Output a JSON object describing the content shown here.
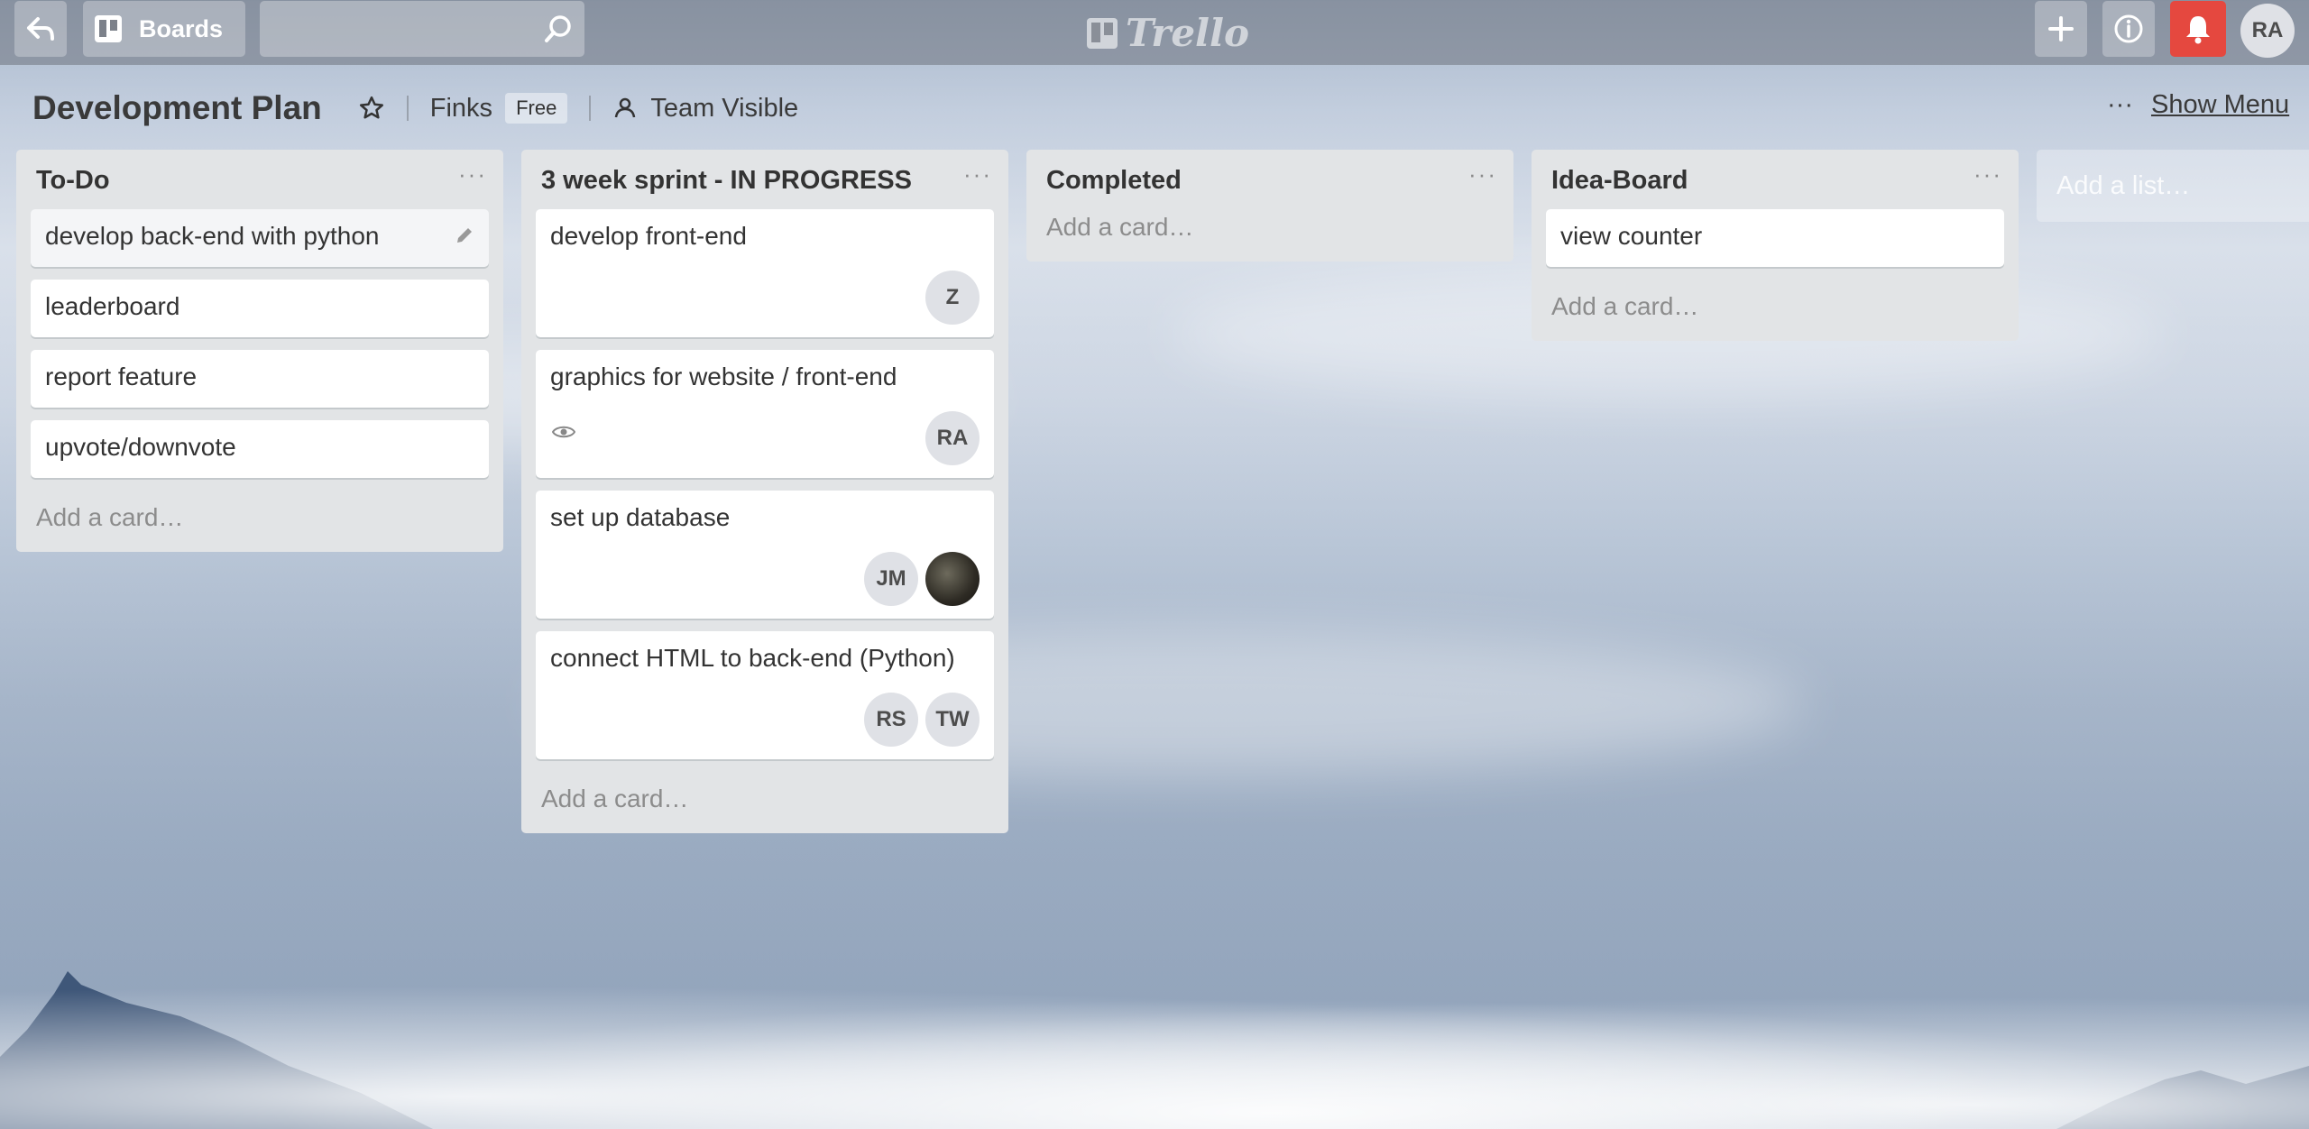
{
  "header": {
    "boards_label": "Boards",
    "logo_text": "Trello",
    "user_initials": "RA",
    "notification_color": "#e5483f"
  },
  "board": {
    "title": "Development Plan",
    "org_name": "Finks",
    "org_plan": "Free",
    "visibility": "Team Visible",
    "show_menu_label": "Show Menu",
    "menu_dots": "···"
  },
  "lists": [
    {
      "title": "To-Do",
      "cards": [
        {
          "title": "develop back-end with python"
        },
        {
          "title": "leaderboard"
        },
        {
          "title": "report feature"
        },
        {
          "title": "upvote/downvote"
        }
      ],
      "add_card": "Add a card…"
    },
    {
      "title": "3 week sprint - IN PROGRESS",
      "cards": [
        {
          "title": "develop front-end",
          "members": [
            "Z"
          ]
        },
        {
          "title": "graphics for website / front-end",
          "members": [
            "RA"
          ],
          "badges": [
            "eye-icon"
          ]
        },
        {
          "title": "set up database",
          "members": [
            "JM",
            "photo-avatar"
          ]
        },
        {
          "title": "connect HTML to back-end (Python)",
          "members": [
            "RS",
            "TW"
          ]
        }
      ],
      "add_card": "Add a card…"
    },
    {
      "title": "Completed",
      "cards": [],
      "add_card": "Add a card…"
    },
    {
      "title": "Idea-Board",
      "cards": [
        {
          "title": "view counter"
        }
      ],
      "add_card": "Add a card…"
    }
  ],
  "add_list": "Add a list…",
  "list_menu": "···"
}
